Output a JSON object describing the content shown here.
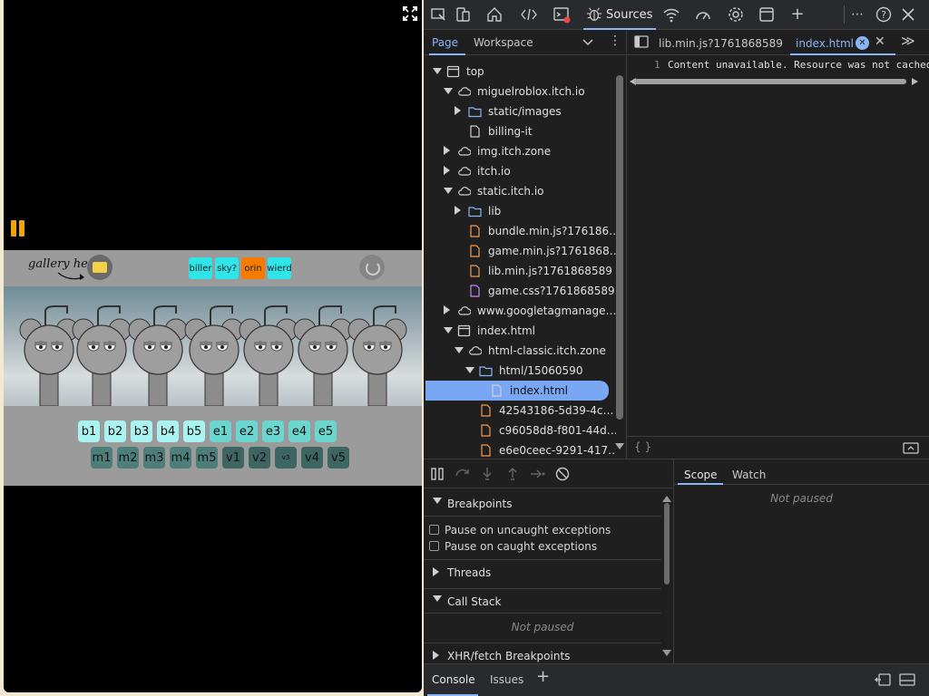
{
  "game": {
    "gallery_label": "gallery here",
    "themes": [
      {
        "label": "biller",
        "color": "#2ee6ea"
      },
      {
        "label": "sky?",
        "color": "#2ee6ea"
      },
      {
        "label": "orin",
        "color": "#f57a00"
      },
      {
        "label": "wierd",
        "color": "#2ee6ea"
      }
    ],
    "row1": [
      "b1",
      "b2",
      "b3",
      "b4",
      "b5",
      "e1",
      "e2",
      "e3",
      "e4",
      "e5"
    ],
    "row2": [
      "m1",
      "m2",
      "m3",
      "m4",
      "m5",
      "v1",
      "v2",
      "v3",
      "v4",
      "v5"
    ]
  },
  "devtools": {
    "active_panel": "Sources",
    "nav_tabs": {
      "page": "Page",
      "workspace": "Workspace"
    },
    "tree": [
      {
        "label": "top",
        "depth": 0,
        "icon": "frame-icon",
        "expand": "down"
      },
      {
        "label": "miguelroblox.itch.io",
        "depth": 1,
        "icon": "cloud-icon",
        "expand": "down"
      },
      {
        "label": "static/images",
        "depth": 2,
        "icon": "folder-icon",
        "expand": "right"
      },
      {
        "label": "billing-it",
        "depth": 2,
        "icon": "file-icon",
        "expand": "none"
      },
      {
        "label": "img.itch.zone",
        "depth": 1,
        "icon": "cloud-icon",
        "expand": "right"
      },
      {
        "label": "itch.io",
        "depth": 1,
        "icon": "cloud-icon",
        "expand": "right"
      },
      {
        "label": "static.itch.io",
        "depth": 1,
        "icon": "cloud-icon",
        "expand": "down"
      },
      {
        "label": "lib",
        "depth": 2,
        "icon": "folder-icon",
        "expand": "right"
      },
      {
        "label": "bundle.min.js?176186…",
        "depth": 2,
        "icon": "js-file-icon",
        "expand": "none"
      },
      {
        "label": "game.min.js?1761868…",
        "depth": 2,
        "icon": "js-file-icon",
        "expand": "none"
      },
      {
        "label": "lib.min.js?1761868589",
        "depth": 2,
        "icon": "js-file-icon",
        "expand": "none"
      },
      {
        "label": "game.css?1761868589",
        "depth": 2,
        "icon": "css-file-icon",
        "expand": "none"
      },
      {
        "label": "www.googletagmanage…",
        "depth": 1,
        "icon": "cloud-icon",
        "expand": "right"
      },
      {
        "label": "index.html",
        "depth": 1,
        "icon": "frame-icon",
        "expand": "down"
      },
      {
        "label": "html-classic.itch.zone",
        "depth": 2,
        "icon": "cloud-icon",
        "expand": "down"
      },
      {
        "label": "html/15060590",
        "depth": 3,
        "icon": "folder-icon",
        "expand": "down"
      },
      {
        "label": "index.html",
        "depth": 4,
        "icon": "file-icon",
        "expand": "none",
        "selected": true
      },
      {
        "label": "42543186-5d39-4c…",
        "depth": 3,
        "icon": "js-file-icon",
        "expand": "none"
      },
      {
        "label": "c96058d8-f801-44d…",
        "depth": 3,
        "icon": "js-file-icon",
        "expand": "none"
      },
      {
        "label": "e6e0ceec-9291-417…",
        "depth": 3,
        "icon": "js-file-icon",
        "expand": "none"
      }
    ],
    "editor_tabs": [
      {
        "label": "lib.min.js?1761868589",
        "active": false
      },
      {
        "label": "index.html",
        "active": true
      }
    ],
    "code": {
      "line_no": "1",
      "text": "Content unavailable. Resource was not cached"
    },
    "editor_footer": "{ }",
    "sections": {
      "breakpoints": "Breakpoints",
      "pause_uncaught": "Pause on uncaught exceptions",
      "pause_caught": "Pause on caught exceptions",
      "threads": "Threads",
      "call_stack": "Call Stack",
      "not_paused": "Not paused",
      "xhr": "XHR/fetch Breakpoints"
    },
    "scope_tabs": {
      "scope": "Scope",
      "watch": "Watch"
    },
    "scope_status": "Not paused",
    "drawer_tabs": {
      "console": "Console",
      "issues": "Issues"
    }
  }
}
